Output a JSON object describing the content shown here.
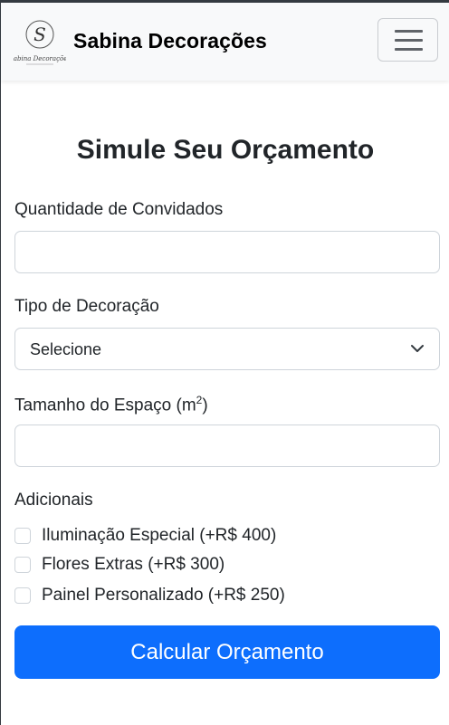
{
  "navbar": {
    "brand": "Sabina Decorações",
    "logo_initial": "S",
    "logo_script": "Sabina Decorações",
    "toggler_icon": "hamburger-menu-icon"
  },
  "form": {
    "title": "Simule Seu Orçamento",
    "guests_label": "Quantidade de Convidados",
    "guests_value": "",
    "decoration_label": "Tipo de Decoração",
    "decoration_selected": "Selecione",
    "space_label_main": "Tamanho do Espaço (m",
    "space_label_sup": "2",
    "space_label_end": ")",
    "space_value": "",
    "extras_label": "Adicionais",
    "extras": [
      {
        "label": "Iluminação Especial (+R$ 400)",
        "checked": false
      },
      {
        "label": "Flores Extras (+R$ 300)",
        "checked": false
      },
      {
        "label": "Painel Personalizado (+R$ 250)",
        "checked": false
      }
    ],
    "submit_label": "Calcular Orçamento"
  },
  "colors": {
    "primary": "#0d6efd",
    "navbar_bg": "#f8f9fa",
    "text": "#212529",
    "border": "#ced4da"
  }
}
